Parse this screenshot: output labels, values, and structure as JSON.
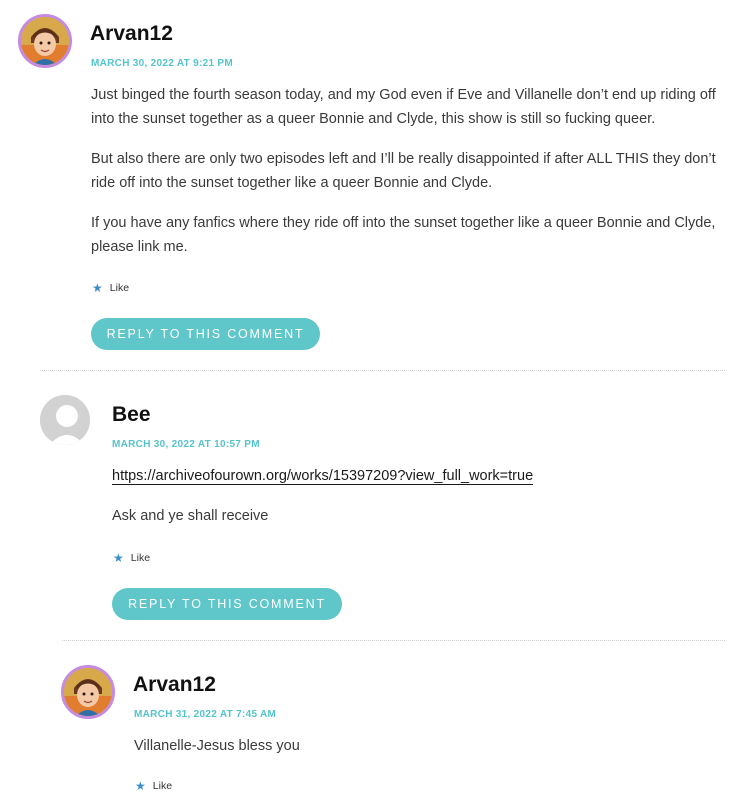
{
  "comments": [
    {
      "author": "Arvan12",
      "timestamp": "MARCH 30, 2022 AT 9:21 PM",
      "paragraphs": [
        "Just binged the fourth season today, and my God even if Eve and Villanelle don’t end up riding off into the sunset together as a queer Bonnie and Clyde, this show is still so fucking queer.",
        "But also there are only two episodes left and I’ll be really disappointed if after ALL THIS they don’t ride off into the sunset together like a queer Bonnie and Clyde.",
        "If you have any fanfics where they ride off into the sunset together like a queer Bonnie and Clyde, please link me."
      ],
      "like_label": "Like",
      "reply_label": "REPLY TO THIS COMMENT"
    },
    {
      "author": "Bee",
      "timestamp": "MARCH 30, 2022 AT 10:57 PM",
      "link": "https://archiveofourown.org/works/15397209?view_full_work=true",
      "paragraphs": [
        "Ask and ye shall receive"
      ],
      "like_label": "Like",
      "reply_label": "REPLY TO THIS COMMENT"
    },
    {
      "author": "Arvan12",
      "timestamp": "MARCH 31, 2022 AT 7:45 AM",
      "paragraphs": [
        "Villanelle-Jesus bless you"
      ],
      "like_label": "Like"
    }
  ],
  "colors": {
    "accent": "#55c3cb",
    "button": "#5fc6c9",
    "avatar_border": "#c58be0",
    "like_star": "#3d8fc6"
  },
  "icons": {
    "like": "star-icon",
    "avatar_default": "default-person-icon"
  }
}
